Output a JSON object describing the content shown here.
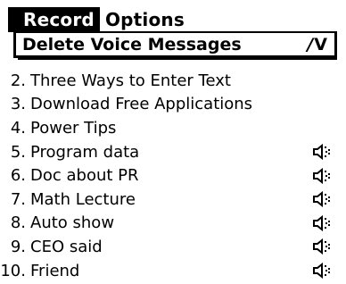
{
  "menubar": {
    "menus": [
      {
        "label": "Record",
        "active": true
      },
      {
        "label": "Options",
        "active": false
      }
    ]
  },
  "dropdown": {
    "items": [
      {
        "label": "Delete Voice Messages",
        "shortcut_stroke": "/",
        "shortcut_key": "V"
      }
    ]
  },
  "list": {
    "rows": [
      {
        "number": "2.",
        "title": "Three Ways to Enter Text",
        "voice": false
      },
      {
        "number": "3.",
        "title": "Download Free Applications",
        "voice": false
      },
      {
        "number": "4.",
        "title": "Power Tips",
        "voice": false
      },
      {
        "number": "5.",
        "title": "Program data",
        "voice": true
      },
      {
        "number": "6.",
        "title": "Doc about PR",
        "voice": true
      },
      {
        "number": "7.",
        "title": "Math Lecture",
        "voice": true
      },
      {
        "number": "8.",
        "title": "Auto show",
        "voice": true
      },
      {
        "number": "9.",
        "title": "CEO said",
        "voice": true
      },
      {
        "number": "10.",
        "title": "Friend",
        "voice": true
      }
    ],
    "voice_icon": "speaker-icon"
  }
}
